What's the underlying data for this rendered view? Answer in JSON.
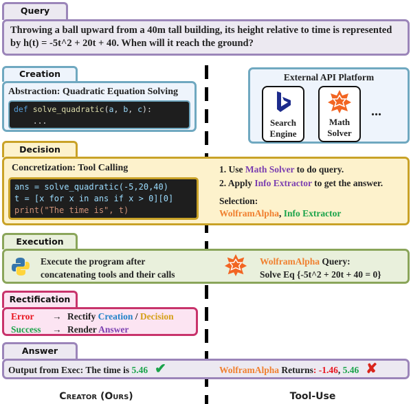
{
  "query": {
    "label": "Query",
    "text": "Throwing a ball upward from a 40m tall building, its height relative to time is represented by h(t) = -5t^2 + 20t + 40. When will it reach the ground?"
  },
  "creation": {
    "label": "Creation",
    "title": "Abstraction: Quadratic Equation Solving",
    "code": {
      "def": "def",
      "fn": "solve_quadratic",
      "args_open": "(",
      "a": "a",
      ", ": ", ",
      "b": "b",
      "c": "c",
      "close": "):",
      "body": "    ..."
    }
  },
  "api": {
    "title": "External API Platform",
    "tools": [
      {
        "name": "Search Engine",
        "icon": "bing-icon"
      },
      {
        "name": "Math Solver",
        "icon": "wolfram-icon"
      }
    ],
    "more": "..."
  },
  "decision": {
    "label": "Decision",
    "title": "Concretization: Tool Calling",
    "code_lines": [
      "ans = solve_quadratic(-5,20,40)",
      "t = [x for x in ans if x > 0][0]",
      "print(\"The time is\", t)"
    ],
    "steps": [
      {
        "pre": "1. Use ",
        "tool": "Math Solver",
        "post": " to do query."
      },
      {
        "pre": "2. Apply ",
        "tool": "Info Extractor",
        "post": " to get the answer."
      }
    ],
    "selection_label": "Selection:",
    "selection": [
      "WolframAlpha",
      ", ",
      "Info Extractor"
    ]
  },
  "execution": {
    "label": "Execution",
    "left_text_1": "Execute the program after",
    "left_text_2": "concatenating tools and their calls",
    "right_tool": "WolframAlpha",
    "right_query": " Query:",
    "right_eq": "Solve Eq {-5t^2 + 20t + 40 = 0}"
  },
  "rectification": {
    "label": "Rectification",
    "error": "Error",
    "arrow": "→",
    "rectify": "Rectify ",
    "creation": "Creation",
    "slash": " / ",
    "decision": "Decision",
    "success": "Success",
    "render": "Render ",
    "answer": "Answer"
  },
  "answer": {
    "label": "Answer",
    "left": "Output from Exec: The time is ",
    "left_value": "5.46",
    "right_tool": "WolframAlpha",
    "right_text": " Returns",
    "colon": ": ",
    "neg": "-1.46",
    "comma": ", ",
    "pos": "5.46"
  },
  "footer": {
    "left": "Creator (Ours)",
    "right": "Tool-Use"
  },
  "colors": {
    "query": "#9b85b9",
    "creation": "#6fa8c0",
    "decision": "#c9a227",
    "execution": "#8aa55a",
    "rectification": "#c8336b"
  }
}
